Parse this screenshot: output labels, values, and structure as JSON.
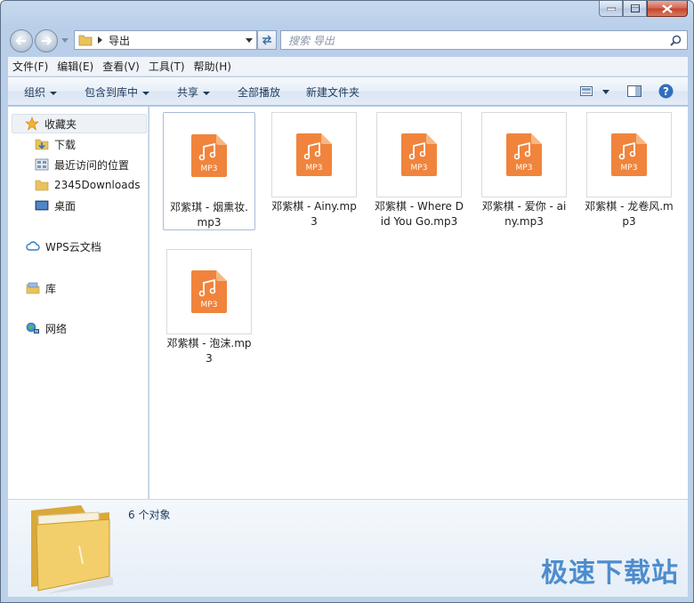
{
  "window": {
    "buttons": [
      "minimize",
      "maximize",
      "close"
    ]
  },
  "address": {
    "path": "导出",
    "search_placeholder": "搜索 导出"
  },
  "menu": [
    "文件(F)",
    "编辑(E)",
    "查看(V)",
    "工具(T)",
    "帮助(H)"
  ],
  "commands": {
    "organize": "组织",
    "include_library": "包含到库中",
    "share": "共享",
    "play_all": "全部播放",
    "new_folder": "新建文件夹"
  },
  "nav": {
    "favorites": "收藏夹",
    "downloads": "下载",
    "recent": "最近访问的位置",
    "downloads2345": "2345Downloads",
    "desktop": "桌面",
    "wps": "WPS云文档",
    "library": "库",
    "network": "网络"
  },
  "files": [
    {
      "name": "邓紫琪 - 烟熏妆.mp3",
      "badge": "MP3"
    },
    {
      "name": "邓紫棋 - Ainy.mp3",
      "badge": "MP3"
    },
    {
      "name": "邓紫棋 - Where Did You Go.mp3",
      "badge": "MP3"
    },
    {
      "name": "邓紫棋 - 爱你 - ainy.mp3",
      "badge": "MP3"
    },
    {
      "name": "邓紫棋 - 龙卷风.mp3",
      "badge": "MP3"
    },
    {
      "name": "邓紫棋 - 泡沫.mp3",
      "badge": "MP3"
    }
  ],
  "status": {
    "count": "6 个对象"
  },
  "watermark": "极速下载站",
  "colors": {
    "mp3_orange": "#f0843c",
    "accent_blue": "#3d83c9"
  }
}
